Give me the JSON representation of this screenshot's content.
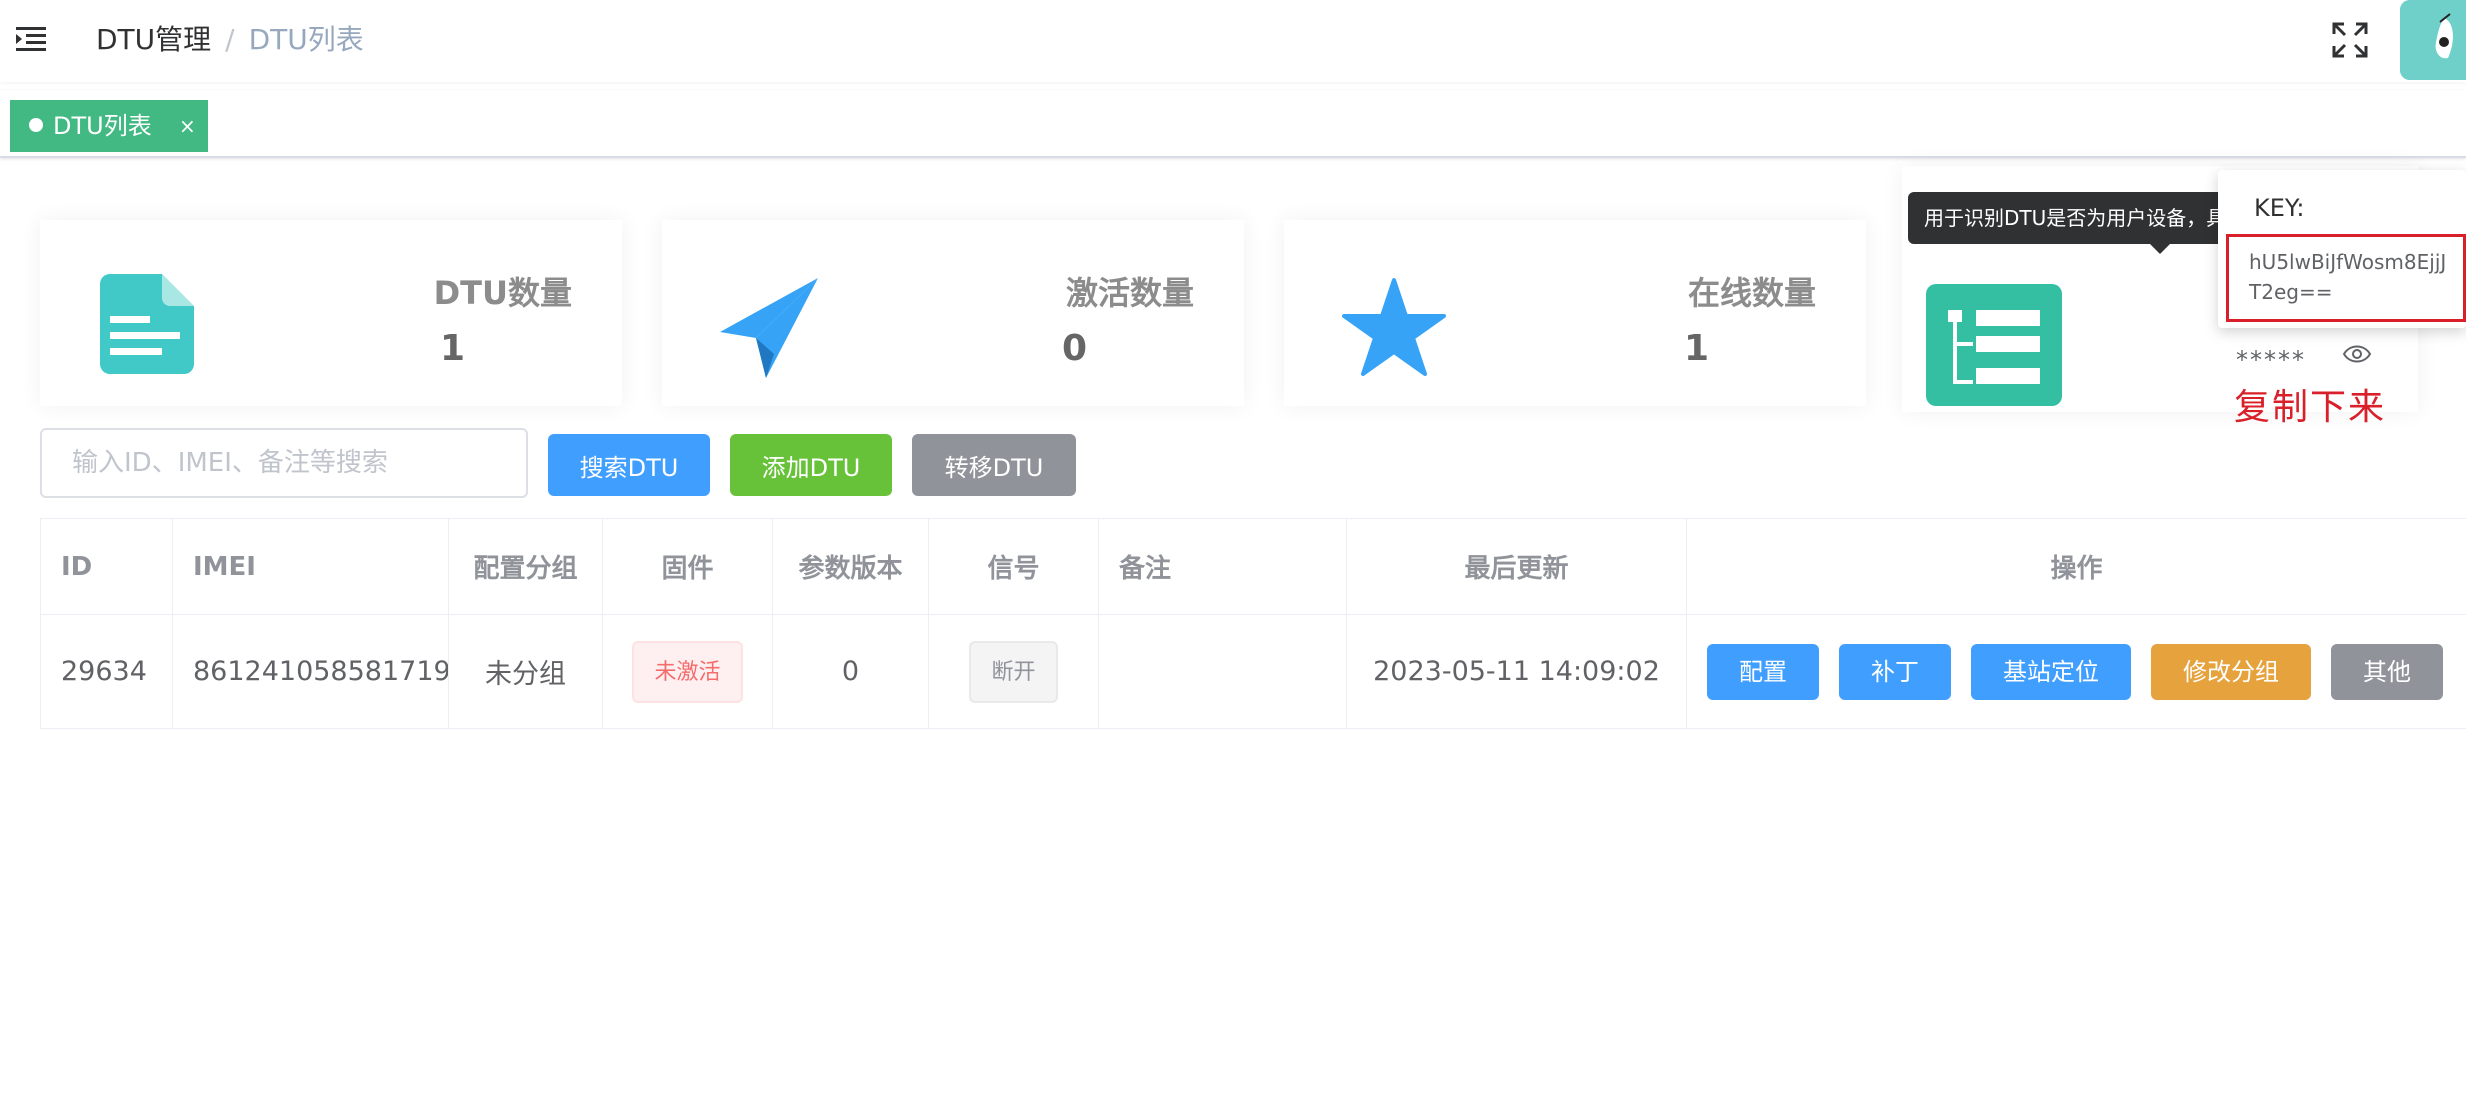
{
  "breadcrumb": {
    "parent": "DTU管理",
    "separator": "/",
    "current": "DTU列表"
  },
  "tags": {
    "active_label": "DTU列表",
    "close": "×"
  },
  "cards": [
    {
      "title": "DTU数量",
      "value": "1",
      "icon": "document-icon",
      "color": "#40c9c6"
    },
    {
      "title": "激活数量",
      "value": "0",
      "icon": "paper-plane-icon",
      "color": "#36a3f7"
    },
    {
      "title": "在线数量",
      "value": "1",
      "icon": "star-icon",
      "color": "#36a3f7"
    },
    {
      "key_masked": "*****",
      "icon": "tree-icon",
      "color": "#34bfa3"
    }
  ],
  "tooltip": {
    "text": "用于识别DTU是否为用户设备，具"
  },
  "popover": {
    "title": "KEY:",
    "key_value": "hU5lwBiJfWosm8EjjJT2eg=="
  },
  "annotation": "复制下来",
  "search": {
    "placeholder": "输入ID、IMEI、备注等搜索",
    "search_btn": "搜索DTU",
    "add_btn": "添加DTU",
    "move_btn": "转移DTU"
  },
  "table": {
    "headers": [
      "ID",
      "IMEI",
      "配置分组",
      "固件",
      "参数版本",
      "信号",
      "备注",
      "最后更新",
      "操作"
    ],
    "rows": [
      {
        "id": "29634",
        "imei": "861241058581719",
        "group": "未分组",
        "firmware": "未激活",
        "param_version": "0",
        "signal": "断开",
        "note": "",
        "updated": "2023-05-11 14:09:02",
        "actions": [
          "配置",
          "补丁",
          "基站定位",
          "修改分组",
          "其他"
        ]
      }
    ]
  }
}
